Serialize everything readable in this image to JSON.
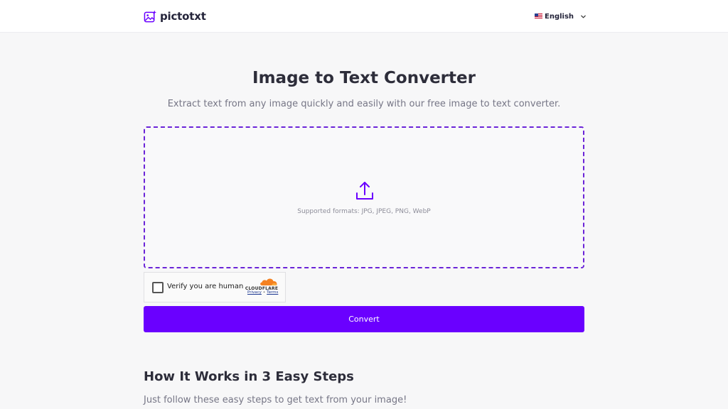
{
  "header": {
    "brand_name": "pictotxt",
    "language": "English",
    "icons": [
      "image-sparkle-icon",
      "us-flag-icon",
      "chevron-down-icon"
    ]
  },
  "hero": {
    "title": "Image to Text Converter",
    "subtitle": "Extract text from any image quickly and easily with our free image to text converter."
  },
  "dropzone": {
    "icon": "upload-icon",
    "formats": "Supported formats: JPG, JPEG, PNG, WebP"
  },
  "captcha": {
    "label": "Verify you are human",
    "provider": "CLOUDFLARE",
    "privacy": "Privacy",
    "separator": "•",
    "terms": "Terms"
  },
  "actions": {
    "convert_label": "Convert"
  },
  "how_it_works": {
    "title": "How It Works in 3 Easy Steps",
    "subtitle": "Just follow these easy steps to get text from your image!"
  },
  "colors": {
    "accent": "#6a00ff",
    "dashed_border": "#6b24d8",
    "cloudflare_orange": "#f48120"
  }
}
